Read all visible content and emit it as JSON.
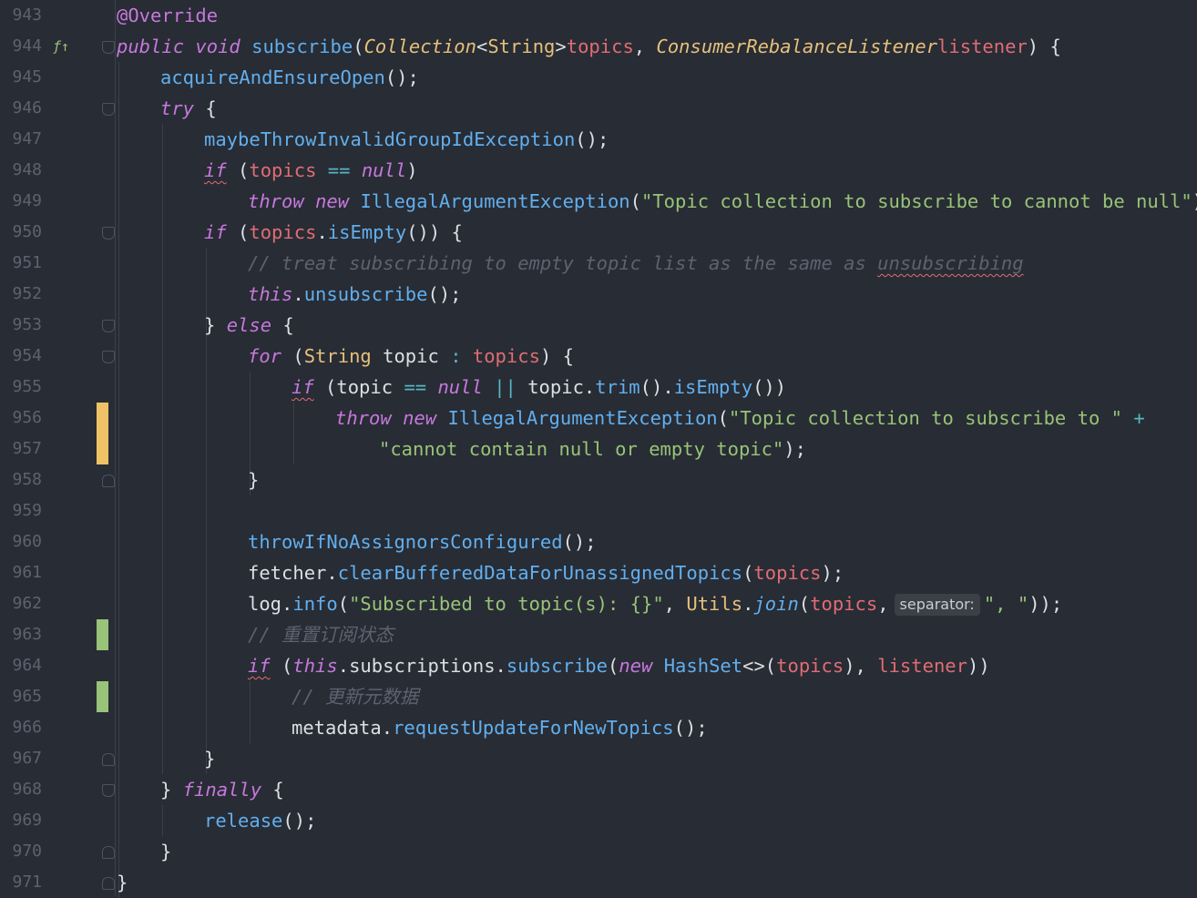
{
  "theme": {
    "background": "#282c34",
    "keyword": "#c678dd",
    "method": "#61afef",
    "type": "#e5c07b",
    "parameter": "#e06c75",
    "string": "#98c379",
    "comment": "#5c6370",
    "vcs_modified": "#f0c266",
    "vcs_added": "#98c379"
  },
  "gutter_icons": {
    "override_icon": "override-method-icon"
  },
  "inlay_hint": "separator:",
  "lines": [
    {
      "n": "943",
      "tokens": [
        [
          "a",
          "@Override"
        ]
      ]
    },
    {
      "n": "944",
      "tokens": [
        [
          "k",
          "public"
        ],
        [
          "",
          "·"
        ],
        [
          "k",
          "void"
        ],
        [
          "",
          "·"
        ],
        [
          "m",
          "subscribe"
        ],
        [
          "v",
          "("
        ],
        [
          "ti",
          "Collection"
        ],
        [
          "v",
          "<"
        ],
        [
          "t",
          "String"
        ],
        [
          "v",
          ">"
        ],
        [
          "",
          ""
        ],
        [
          "p",
          "topics"
        ],
        [
          "v",
          ", "
        ],
        [
          "ti",
          "ConsumerRebalanceListener"
        ],
        [
          "",
          ""
        ],
        [
          "p",
          "listener"
        ],
        [
          "v",
          ") {"
        ]
      ]
    },
    {
      "n": "945",
      "tokens": [
        [
          "m",
          "acquireAndEnsureOpen"
        ],
        [
          "v",
          "();"
        ]
      ]
    },
    {
      "n": "946",
      "tokens": [
        [
          "k",
          "try"
        ],
        [
          "v",
          " {"
        ]
      ]
    },
    {
      "n": "947",
      "tokens": [
        [
          "m",
          "maybeThrowInvalidGroupIdException"
        ],
        [
          "v",
          "();"
        ]
      ]
    },
    {
      "n": "948",
      "tokens": [
        [
          "k",
          "if"
        ],
        [
          "v",
          " ("
        ],
        [
          "p",
          "topics"
        ],
        [
          "v",
          " "
        ],
        [
          "o",
          "=="
        ],
        [
          "v",
          " "
        ],
        [
          "k",
          "null"
        ],
        [
          "v",
          ")"
        ]
      ]
    },
    {
      "n": "949",
      "tokens": [
        [
          "k",
          "throw"
        ],
        [
          "v",
          " "
        ],
        [
          "k",
          "new"
        ],
        [
          "v",
          " "
        ],
        [
          "m",
          "IllegalArgumentException"
        ],
        [
          "v",
          "("
        ],
        [
          "s",
          "\"Topic collection to subscribe to cannot be null\""
        ],
        [
          "v",
          ");"
        ]
      ]
    },
    {
      "n": "950",
      "tokens": [
        [
          "k",
          "if"
        ],
        [
          "v",
          " ("
        ],
        [
          "p",
          "topics"
        ],
        [
          "v",
          "."
        ],
        [
          "m",
          "isEmpty"
        ],
        [
          "v",
          "()) {"
        ]
      ]
    },
    {
      "n": "951",
      "tokens": [
        [
          "c",
          "// treat subscribing to empty topic list as the same as "
        ],
        [
          "c",
          "unsubscribing"
        ]
      ]
    },
    {
      "n": "952",
      "tokens": [
        [
          "k",
          "this"
        ],
        [
          "v",
          "."
        ],
        [
          "m",
          "unsubscribe"
        ],
        [
          "v",
          "();"
        ]
      ]
    },
    {
      "n": "953",
      "tokens": [
        [
          "v",
          "} "
        ],
        [
          "k",
          "else"
        ],
        [
          "v",
          " {"
        ]
      ]
    },
    {
      "n": "954",
      "tokens": [
        [
          "k",
          "for"
        ],
        [
          "v",
          " ("
        ],
        [
          "t",
          "String"
        ],
        [
          "v",
          " topic "
        ],
        [
          "o",
          ":"
        ],
        [
          "v",
          " "
        ],
        [
          "p",
          "topics"
        ],
        [
          "v",
          ") {"
        ]
      ]
    },
    {
      "n": "955",
      "tokens": [
        [
          "k",
          "if"
        ],
        [
          "v",
          " (topic "
        ],
        [
          "o",
          "=="
        ],
        [
          "v",
          " "
        ],
        [
          "k",
          "null"
        ],
        [
          "v",
          " "
        ],
        [
          "o",
          "||"
        ],
        [
          "v",
          " topic."
        ],
        [
          "m",
          "trim"
        ],
        [
          "v",
          "()."
        ],
        [
          "m",
          "isEmpty"
        ],
        [
          "v",
          "())"
        ]
      ]
    },
    {
      "n": "956",
      "tokens": [
        [
          "k",
          "throw"
        ],
        [
          "v",
          " "
        ],
        [
          "k",
          "new"
        ],
        [
          "v",
          " "
        ],
        [
          "m",
          "IllegalArgumentException"
        ],
        [
          "v",
          "("
        ],
        [
          "s",
          "\"Topic collection to subscribe to \""
        ],
        [
          "v",
          " "
        ],
        [
          "o",
          "+"
        ]
      ]
    },
    {
      "n": "957",
      "tokens": [
        [
          "s",
          "\"cannot contain null or empty topic\""
        ],
        [
          "v",
          ");"
        ]
      ]
    },
    {
      "n": "958",
      "tokens": [
        [
          "v",
          "}"
        ]
      ]
    },
    {
      "n": "959",
      "tokens": []
    },
    {
      "n": "960",
      "tokens": [
        [
          "m",
          "throwIfNoAssignorsConfigured"
        ],
        [
          "v",
          "();"
        ]
      ]
    },
    {
      "n": "961",
      "tokens": [
        [
          "v",
          "fetcher."
        ],
        [
          "m",
          "clearBufferedDataForUnassignedTopics"
        ],
        [
          "v",
          "("
        ],
        [
          "p",
          "topics"
        ],
        [
          "v",
          ");"
        ]
      ]
    },
    {
      "n": "962",
      "tokens": [
        [
          "v",
          "log."
        ],
        [
          "m",
          "info"
        ],
        [
          "v",
          "("
        ],
        [
          "s",
          "\"Subscribed to topic(s): {}\""
        ],
        [
          "v",
          ", "
        ],
        [
          "t",
          "Utils"
        ],
        [
          "v",
          "."
        ],
        [
          "mi",
          "join"
        ],
        [
          "v",
          "("
        ],
        [
          "p",
          "topics"
        ],
        [
          "v",
          ","
        ],
        [
          "hint",
          "separator:"
        ],
        [
          "s",
          "\", \""
        ],
        [
          "v",
          "));"
        ]
      ]
    },
    {
      "n": "963",
      "tokens": [
        [
          "c",
          "// 重置订阅状态"
        ]
      ]
    },
    {
      "n": "964",
      "tokens": [
        [
          "k",
          "if"
        ],
        [
          "v",
          " ("
        ],
        [
          "k",
          "this"
        ],
        [
          "v",
          ".subscriptions."
        ],
        [
          "m",
          "subscribe"
        ],
        [
          "v",
          "("
        ],
        [
          "k",
          "new"
        ],
        [
          "v",
          " "
        ],
        [
          "m",
          "HashSet"
        ],
        [
          "v",
          "<>("
        ],
        [
          "p",
          "topics"
        ],
        [
          "v",
          "), "
        ],
        [
          "p",
          "listener"
        ],
        [
          "v",
          "))"
        ]
      ]
    },
    {
      "n": "965",
      "tokens": [
        [
          "c",
          "// 更新元数据"
        ]
      ]
    },
    {
      "n": "966",
      "tokens": [
        [
          "v",
          "metadata."
        ],
        [
          "m",
          "requestUpdateForNewTopics"
        ],
        [
          "v",
          "();"
        ]
      ]
    },
    {
      "n": "967",
      "tokens": [
        [
          "v",
          "}"
        ]
      ]
    },
    {
      "n": "968",
      "tokens": [
        [
          "v",
          "} "
        ],
        [
          "k",
          "finally"
        ],
        [
          "v",
          " {"
        ]
      ]
    },
    {
      "n": "969",
      "tokens": [
        [
          "m",
          "release"
        ],
        [
          "v",
          "();"
        ]
      ]
    },
    {
      "n": "970",
      "tokens": [
        [
          "v",
          "}"
        ]
      ]
    },
    {
      "n": "971",
      "tokens": [
        [
          "v",
          "}"
        ]
      ]
    }
  ]
}
